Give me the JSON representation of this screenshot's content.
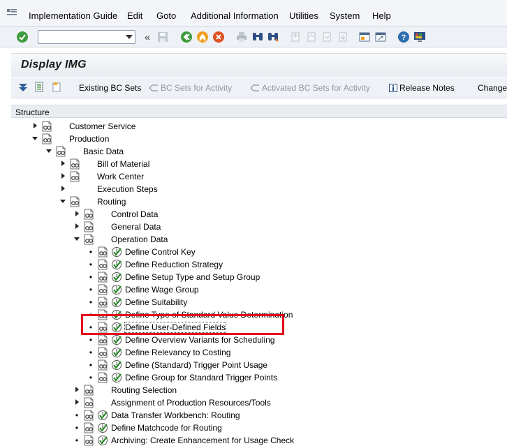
{
  "menu": {
    "items": [
      "Implementation Guide",
      "Edit",
      "Goto",
      "Additional Information",
      "Utilities",
      "System",
      "Help"
    ]
  },
  "command_field": {
    "value": ""
  },
  "title": "Display IMG",
  "app_toolbar": {
    "existing_bc_sets": "Existing BC Sets",
    "bc_sets_for_activity": "BC Sets for Activity",
    "activated_bc_sets_for_activity": "Activated BC Sets for Activity",
    "release_notes": "Release Notes",
    "change": "Change"
  },
  "tree": {
    "header": "Structure",
    "rows": [
      {
        "label": "Customer Service",
        "level": 1,
        "state": "collapsed",
        "activity": false
      },
      {
        "label": "Production",
        "level": 1,
        "state": "expanded",
        "activity": false
      },
      {
        "label": "Basic Data",
        "level": 2,
        "state": "expanded",
        "activity": false
      },
      {
        "label": "Bill of Material",
        "level": 3,
        "state": "collapsed",
        "activity": false
      },
      {
        "label": "Work Center",
        "level": 3,
        "state": "collapsed",
        "activity": false
      },
      {
        "label": "Execution Steps",
        "level": 3,
        "state": "collapsed",
        "activity": false,
        "no_glasses": true
      },
      {
        "label": "Routing",
        "level": 3,
        "state": "expanded",
        "activity": false
      },
      {
        "label": "Control Data",
        "level": 4,
        "state": "collapsed",
        "activity": false
      },
      {
        "label": "General Data",
        "level": 4,
        "state": "collapsed",
        "activity": false
      },
      {
        "label": "Operation Data",
        "level": 4,
        "state": "expanded",
        "activity": false
      },
      {
        "label": "Define Control Key",
        "level": 5,
        "state": "leaf",
        "activity": true
      },
      {
        "label": "Define Reduction Strategy",
        "level": 5,
        "state": "leaf",
        "activity": true
      },
      {
        "label": "Define Setup Type and Setup Group",
        "level": 5,
        "state": "leaf",
        "activity": true
      },
      {
        "label": "Define Wage Group",
        "level": 5,
        "state": "leaf",
        "activity": true
      },
      {
        "label": "Define Suitability",
        "level": 5,
        "state": "leaf",
        "activity": true
      },
      {
        "label": "Define Type of Standard Value Determination",
        "level": 5,
        "state": "leaf",
        "activity": true
      },
      {
        "label": "Define User-Defined Fields",
        "level": 5,
        "state": "leaf",
        "activity": true,
        "selected": true
      },
      {
        "label": "Define Overview Variants for Scheduling",
        "level": 5,
        "state": "leaf",
        "activity": true
      },
      {
        "label": "Define Relevancy to Costing",
        "level": 5,
        "state": "leaf",
        "activity": true
      },
      {
        "label": "Define (Standard) Trigger Point Usage",
        "level": 5,
        "state": "leaf",
        "activity": true
      },
      {
        "label": "Define Group for Standard Trigger Points",
        "level": 5,
        "state": "leaf",
        "activity": true
      },
      {
        "label": "Routing Selection",
        "level": 4,
        "state": "collapsed",
        "activity": false
      },
      {
        "label": "Assignment of Production Resources/Tools",
        "level": 4,
        "state": "collapsed",
        "activity": false
      },
      {
        "label": "Data Transfer Workbench: Routing",
        "level": 4,
        "state": "leaf",
        "activity": true
      },
      {
        "label": "Define Matchcode for Routing",
        "level": 4,
        "state": "leaf",
        "activity": true
      },
      {
        "label": "Archiving: Create Enhancement for Usage Check",
        "level": 4,
        "state": "leaf",
        "activity": true
      }
    ]
  },
  "icons": {
    "app": "sap-app-icon",
    "enter": "green-check-icon",
    "save": "save-icon",
    "back": "back-icon",
    "exit": "exit-icon",
    "cancel": "cancel-icon",
    "print": "print-icon",
    "find": "find-icon",
    "find_next": "find-next-icon",
    "help": "help-icon",
    "layout": "customize-layout-icon"
  },
  "colors": {
    "highlight": "#e3001b",
    "activity_check": "#2a8a2a"
  }
}
